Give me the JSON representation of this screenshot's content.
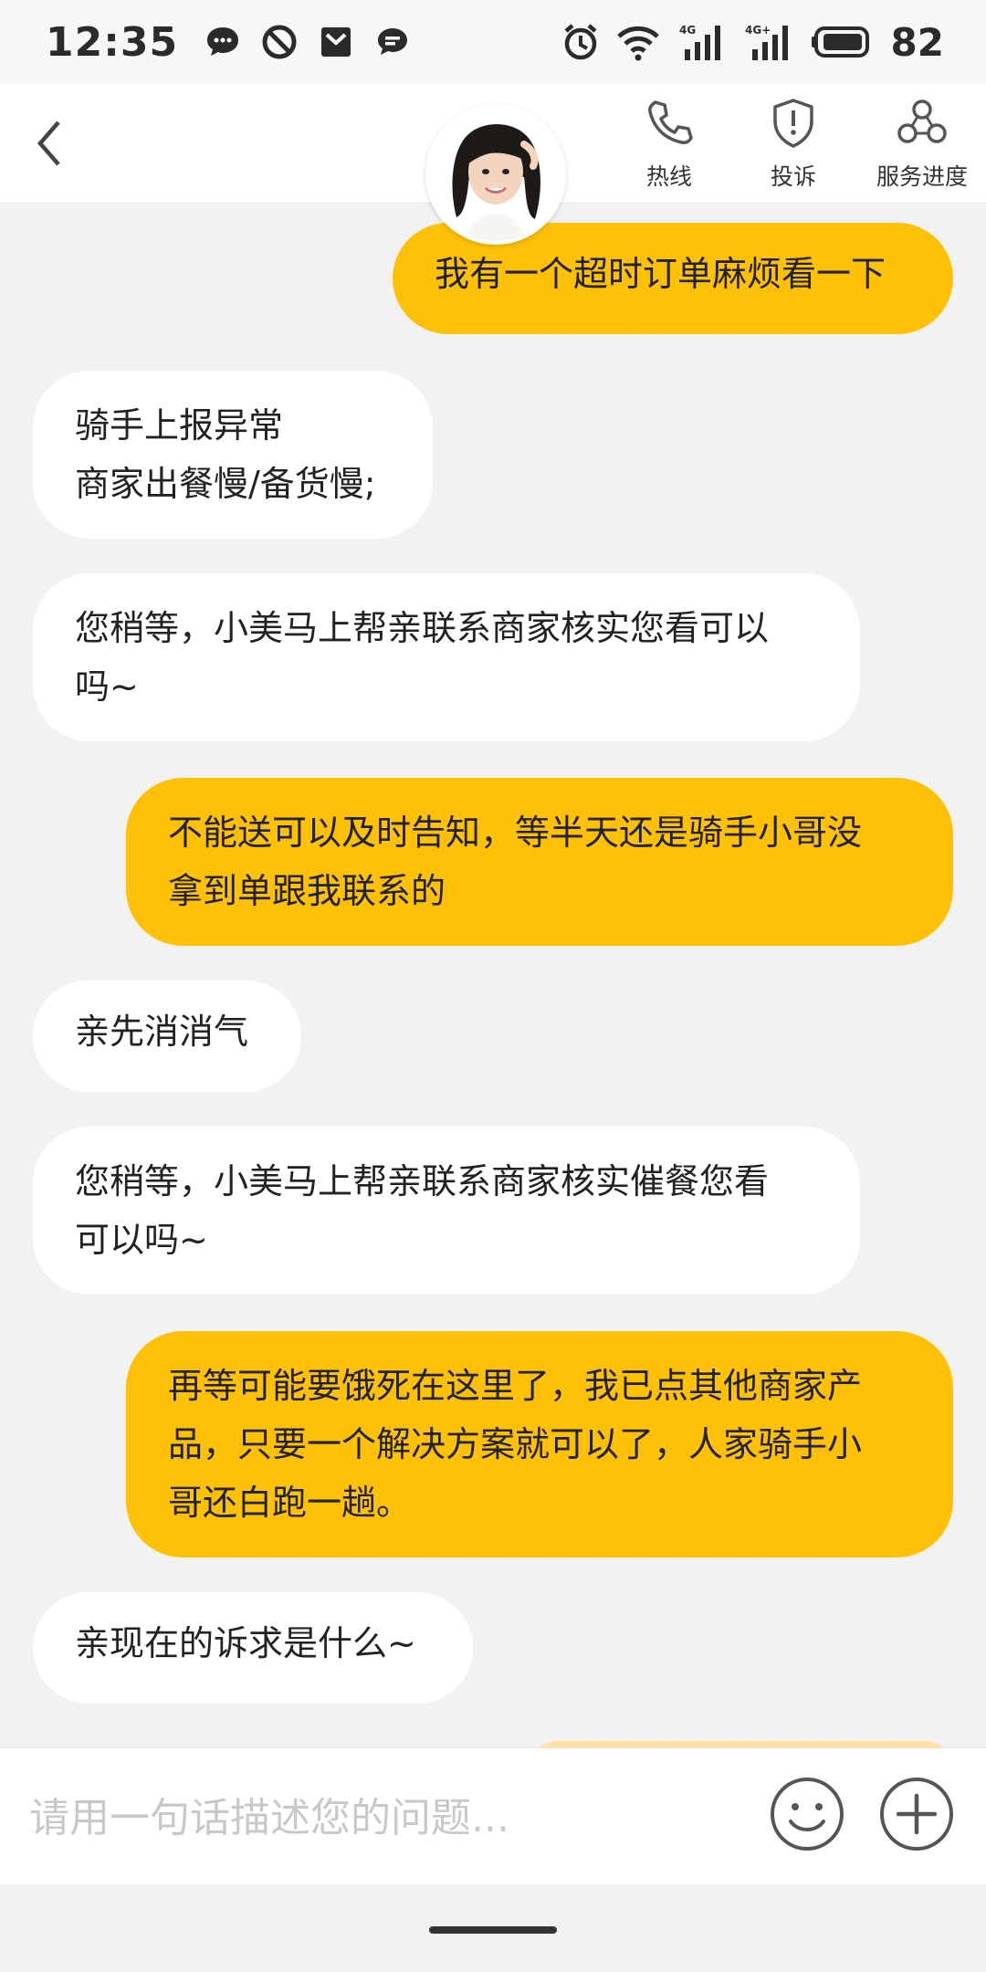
{
  "status_bar": {
    "time": "12:35",
    "battery_level": "82",
    "notification_icons": [
      "chat-bubble-icon",
      "do-not-disturb-icon",
      "mail-icon",
      "message-icon"
    ],
    "system_icons": [
      "alarm-icon",
      "wifi-icon",
      "signal-4g-icon",
      "signal-4g-plus-icon",
      "battery-icon"
    ]
  },
  "header": {
    "hotline_label": "热线",
    "complaint_label": "投诉",
    "progress_label": "服务进度"
  },
  "messages": [
    {
      "side": "out",
      "text": "我有一个超时订单麻烦看一下"
    },
    {
      "side": "in",
      "text": "骑手上报异常\n商家出餐慢/备货慢;"
    },
    {
      "side": "in",
      "text": "您稍等，小美马上帮亲联系商家核实您看可以\n吗~"
    },
    {
      "side": "out",
      "text": "不能送可以及时告知，等半天还是骑手小哥没\n拿到单跟我联系的"
    },
    {
      "side": "in",
      "text": "亲先消消气"
    },
    {
      "side": "in",
      "text": "您稍等，小美马上帮亲联系商家核实催餐您看\n可以吗~"
    },
    {
      "side": "out",
      "text": "再等可能要饿死在这里了，我已点其他商家产\n品，只要一个解决方案就可以了，人家骑手小\n哥还白跑一趟。"
    },
    {
      "side": "in",
      "text": "亲现在的诉求是什么~"
    }
  ],
  "input": {
    "placeholder": "请用一句话描述您的问题...",
    "value": ""
  },
  "colors": {
    "accent": "#ffc107",
    "incoming_bubble": "#ffffff",
    "background": "#f2f2f2"
  }
}
